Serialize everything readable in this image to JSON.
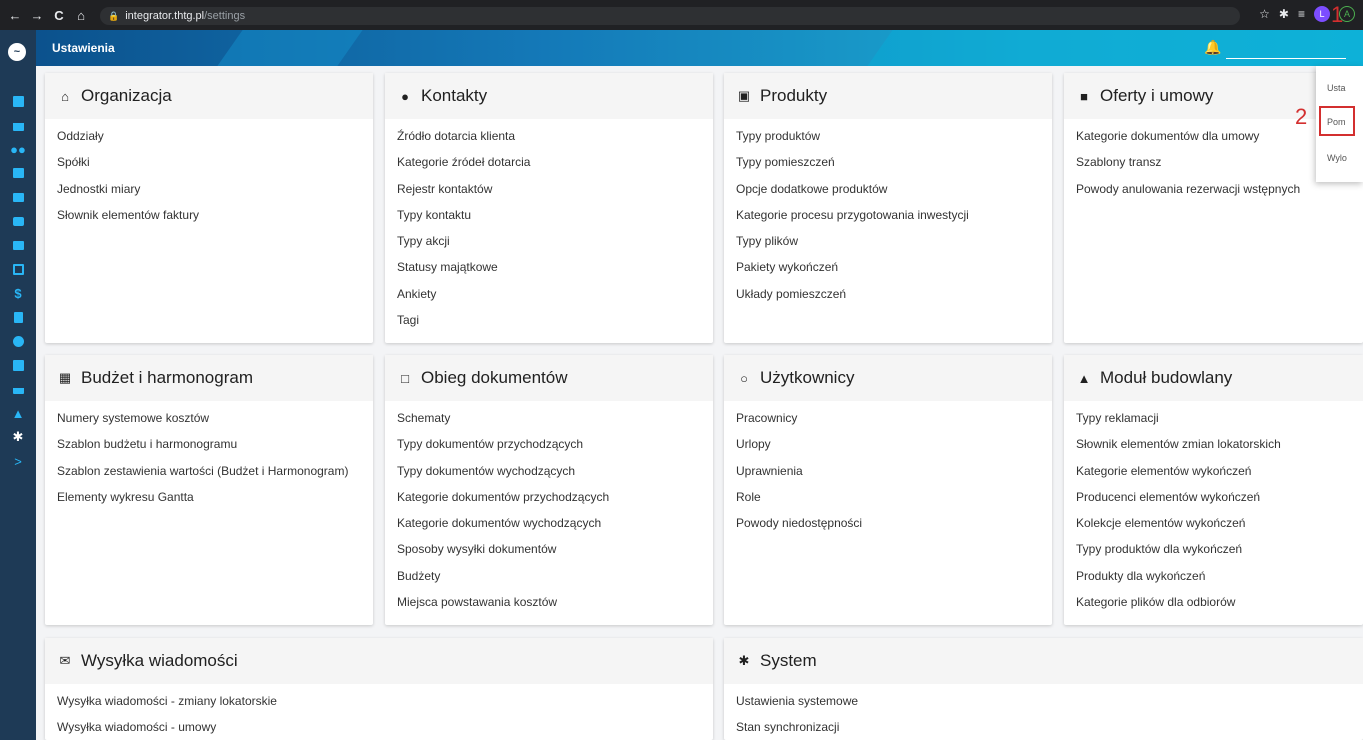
{
  "browser": {
    "back": "←",
    "forward": "→",
    "reload": "C",
    "home": "⌂",
    "url_host": "integrator.thtg.pl",
    "url_path": "/settings",
    "profile_initial": "L",
    "account_initial": "A"
  },
  "header": {
    "title": "Ustawienia",
    "annotation_1": "1"
  },
  "sidebar": {
    "logo": "~",
    "expand": ">"
  },
  "cards": {
    "organizacja": {
      "title": "Organizacja",
      "links": [
        "Oddziały",
        "Spółki",
        "Jednostki miary",
        "Słownik elementów faktury"
      ]
    },
    "kontakty": {
      "title": "Kontakty",
      "links": [
        "Źródło dotarcia klienta",
        "Kategorie źródeł dotarcia",
        "Rejestr kontaktów",
        "Typy kontaktu",
        "Typy akcji",
        "Statusy majątkowe",
        "Ankiety",
        "Tagi"
      ]
    },
    "produkty": {
      "title": "Produkty",
      "links": [
        "Typy produktów",
        "Typy pomieszczeń",
        "Opcje dodatkowe produktów",
        "Kategorie procesu przygotowania inwestycji",
        "Typy plików",
        "Pakiety wykończeń",
        "Układy pomieszczeń"
      ]
    },
    "oferty": {
      "title": "Oferty i umowy",
      "links": [
        "Kategorie dokumentów dla umowy",
        "Szablony transz",
        "Powody anulowania rezerwacji wstępnych"
      ]
    },
    "budzet": {
      "title": "Budżet i harmonogram",
      "links": [
        "Numery systemowe kosztów",
        "Szablon budżetu i harmonogramu",
        "Szablon zestawienia wartości (Budżet i Harmonogram)",
        "Elementy wykresu Gantta"
      ]
    },
    "obieg": {
      "title": "Obieg dokumentów",
      "links": [
        "Schematy",
        "Typy dokumentów przychodzących",
        "Typy dokumentów wychodzących",
        "Kategorie dokumentów przychodzących",
        "Kategorie dokumentów wychodzących",
        "Sposoby wysyłki dokumentów",
        "Budżety",
        "Miejsca powstawania kosztów"
      ]
    },
    "uzytkownicy": {
      "title": "Użytkownicy",
      "links": [
        "Pracownicy",
        "Urlopy",
        "Uprawnienia",
        "Role",
        "Powody niedostępności"
      ]
    },
    "modul": {
      "title": "Moduł budowlany",
      "links": [
        "Typy reklamacji",
        "Słownik elementów zmian lokatorskich",
        "Kategorie elementów wykończeń",
        "Producenci elementów wykończeń",
        "Kolekcje elementów wykończeń",
        "Typy produktów dla wykończeń",
        "Produkty dla wykończeń",
        "Kategorie plików dla odbiorów"
      ]
    },
    "wysylka": {
      "title": "Wysyłka wiadomości",
      "links": [
        "Wysyłka wiadomości - zmiany lokatorskie",
        "Wysyłka wiadomości - umowy"
      ]
    },
    "system": {
      "title": "System",
      "links": [
        "Ustawienia systemowe",
        "Stan synchronizacji"
      ]
    }
  },
  "dropdown": {
    "items": [
      "Usta",
      "Pom",
      "Wylo"
    ],
    "annotation_2": "2"
  },
  "colors": {
    "sidebar": "#1e3a56",
    "sidebar_icon": "#29b6f6",
    "annotation": "#d32f2f"
  }
}
